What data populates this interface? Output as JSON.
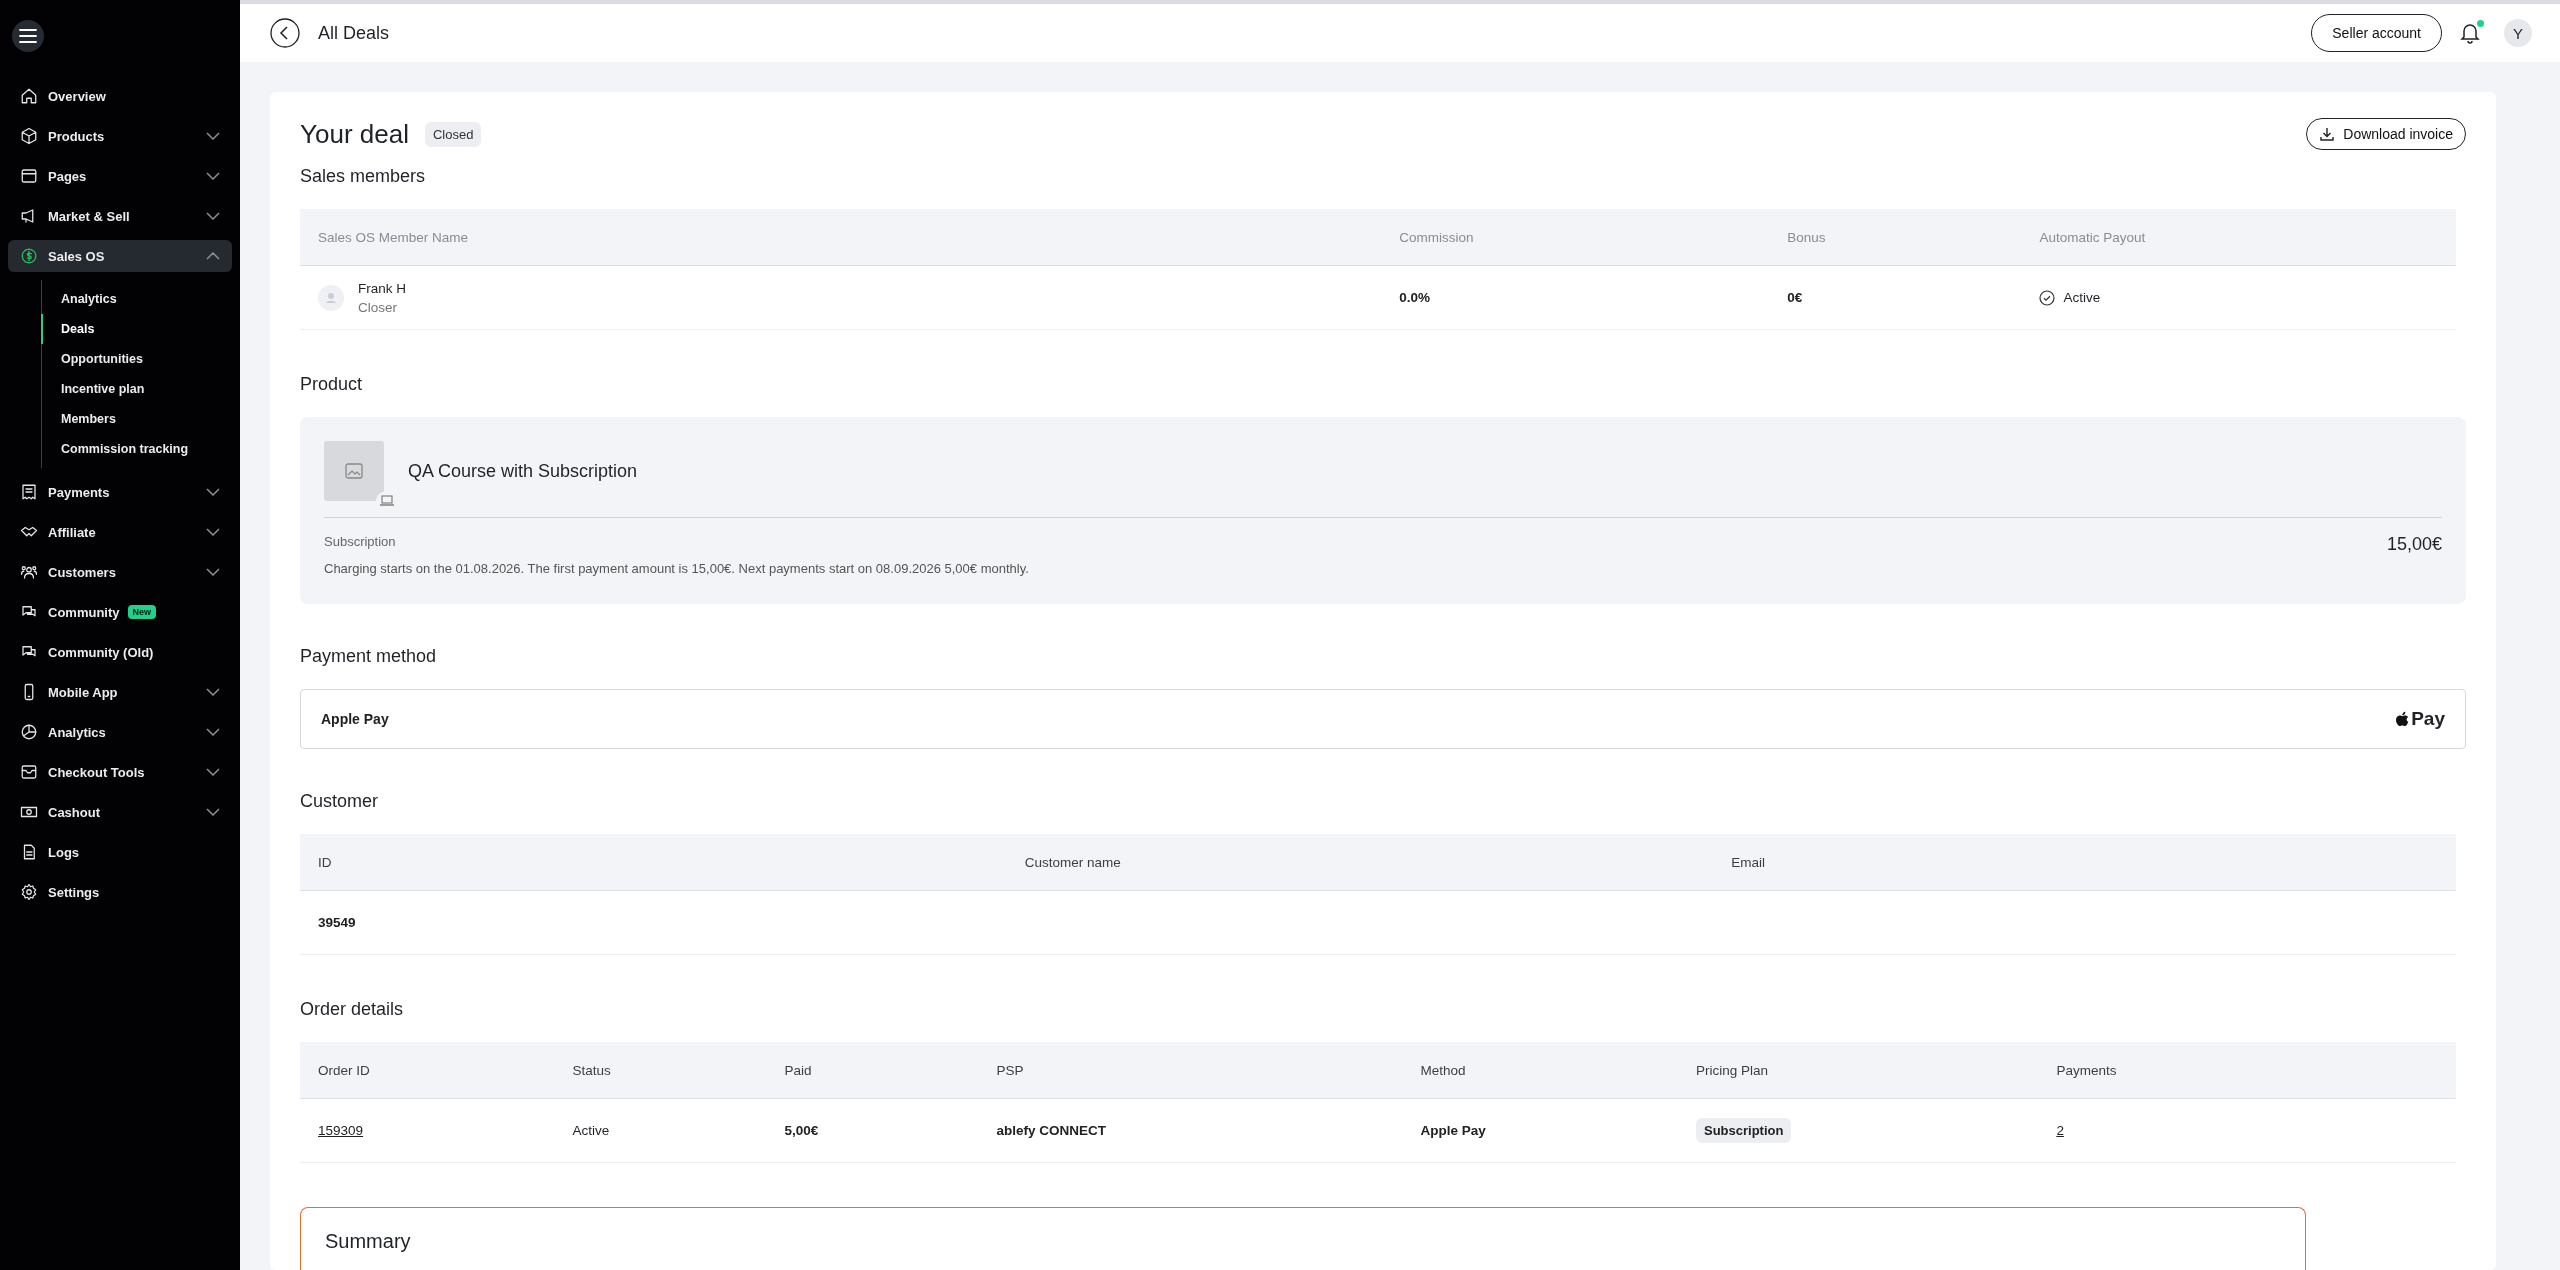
{
  "sidebar": {
    "items": [
      {
        "label": "Overview",
        "selected": false
      },
      {
        "label": "Products",
        "selected": false,
        "expanded": false
      },
      {
        "label": "Pages",
        "selected": false,
        "expanded": false
      },
      {
        "label": "Market & Sell",
        "selected": false,
        "expanded": false
      },
      {
        "label": "Sales OS",
        "selected": true,
        "expanded": true,
        "children": [
          {
            "label": "Analytics",
            "selected": false
          },
          {
            "label": "Deals",
            "selected": true
          },
          {
            "label": "Opportunities",
            "selected": false
          },
          {
            "label": "Incentive plan",
            "selected": false
          },
          {
            "label": "Members",
            "selected": false
          },
          {
            "label": "Commission tracking",
            "selected": false
          }
        ]
      },
      {
        "label": "Payments",
        "selected": false,
        "expanded": false
      },
      {
        "label": "Affiliate",
        "selected": false,
        "expanded": false
      },
      {
        "label": "Customers",
        "selected": false,
        "expanded": false
      },
      {
        "label": "Community",
        "selected": false,
        "badge": "New"
      },
      {
        "label": "Community (Old)",
        "selected": false
      },
      {
        "label": "Mobile App",
        "selected": false,
        "expanded": false
      },
      {
        "label": "Analytics",
        "selected": false,
        "expanded": false
      },
      {
        "label": "Checkout Tools",
        "selected": false,
        "expanded": false
      },
      {
        "label": "Cashout",
        "selected": false,
        "expanded": false
      },
      {
        "label": "Logs",
        "selected": false
      },
      {
        "label": "Settings",
        "selected": false
      }
    ]
  },
  "header": {
    "back_label": "All Deals",
    "seller_button": "Seller account",
    "notification_unread": true,
    "avatar": "Y"
  },
  "deal": {
    "title": "Your deal",
    "status": "Closed",
    "download_button": "Download invoice",
    "sales_members": {
      "title": "Sales members",
      "columns": [
        "Sales OS Member Name",
        "Commission",
        "Bonus",
        "Automatic Payout"
      ],
      "rows": [
        {
          "name": "Frank H",
          "role": "Closer",
          "commission": "0.0%",
          "bonus": "0€",
          "payout": "Active"
        }
      ]
    },
    "product": {
      "title": "Product",
      "name": "QA Course with Subscription",
      "plan": "Subscription",
      "description": "Charging starts on the 01.08.2026. The first payment amount is 15,00€.  Next payments start on 08.09.2026 5,00€ monthly.",
      "price": "15,00€"
    },
    "payment_method": {
      "title": "Payment method",
      "name": "Apple Pay",
      "logo_text": "Pay"
    },
    "customer": {
      "title": "Customer",
      "columns": [
        "ID",
        "Customer name",
        "Email"
      ],
      "rows": [
        [
          "39549"
        ]
      ]
    },
    "order_details": {
      "title": "Order details",
      "columns": [
        "Order ID",
        "Status",
        "Paid",
        "PSP",
        "Method",
        "Pricing Plan",
        "Payments"
      ],
      "rows": [
        {
          "order_id": "159309",
          "status": "Active",
          "paid": "5,00€",
          "psp": "ablefy CONNECT",
          "method": "Apple Pay",
          "pricing_plan": "Subscription",
          "payments": "2"
        }
      ]
    },
    "summary": {
      "title": "Summary"
    }
  }
}
